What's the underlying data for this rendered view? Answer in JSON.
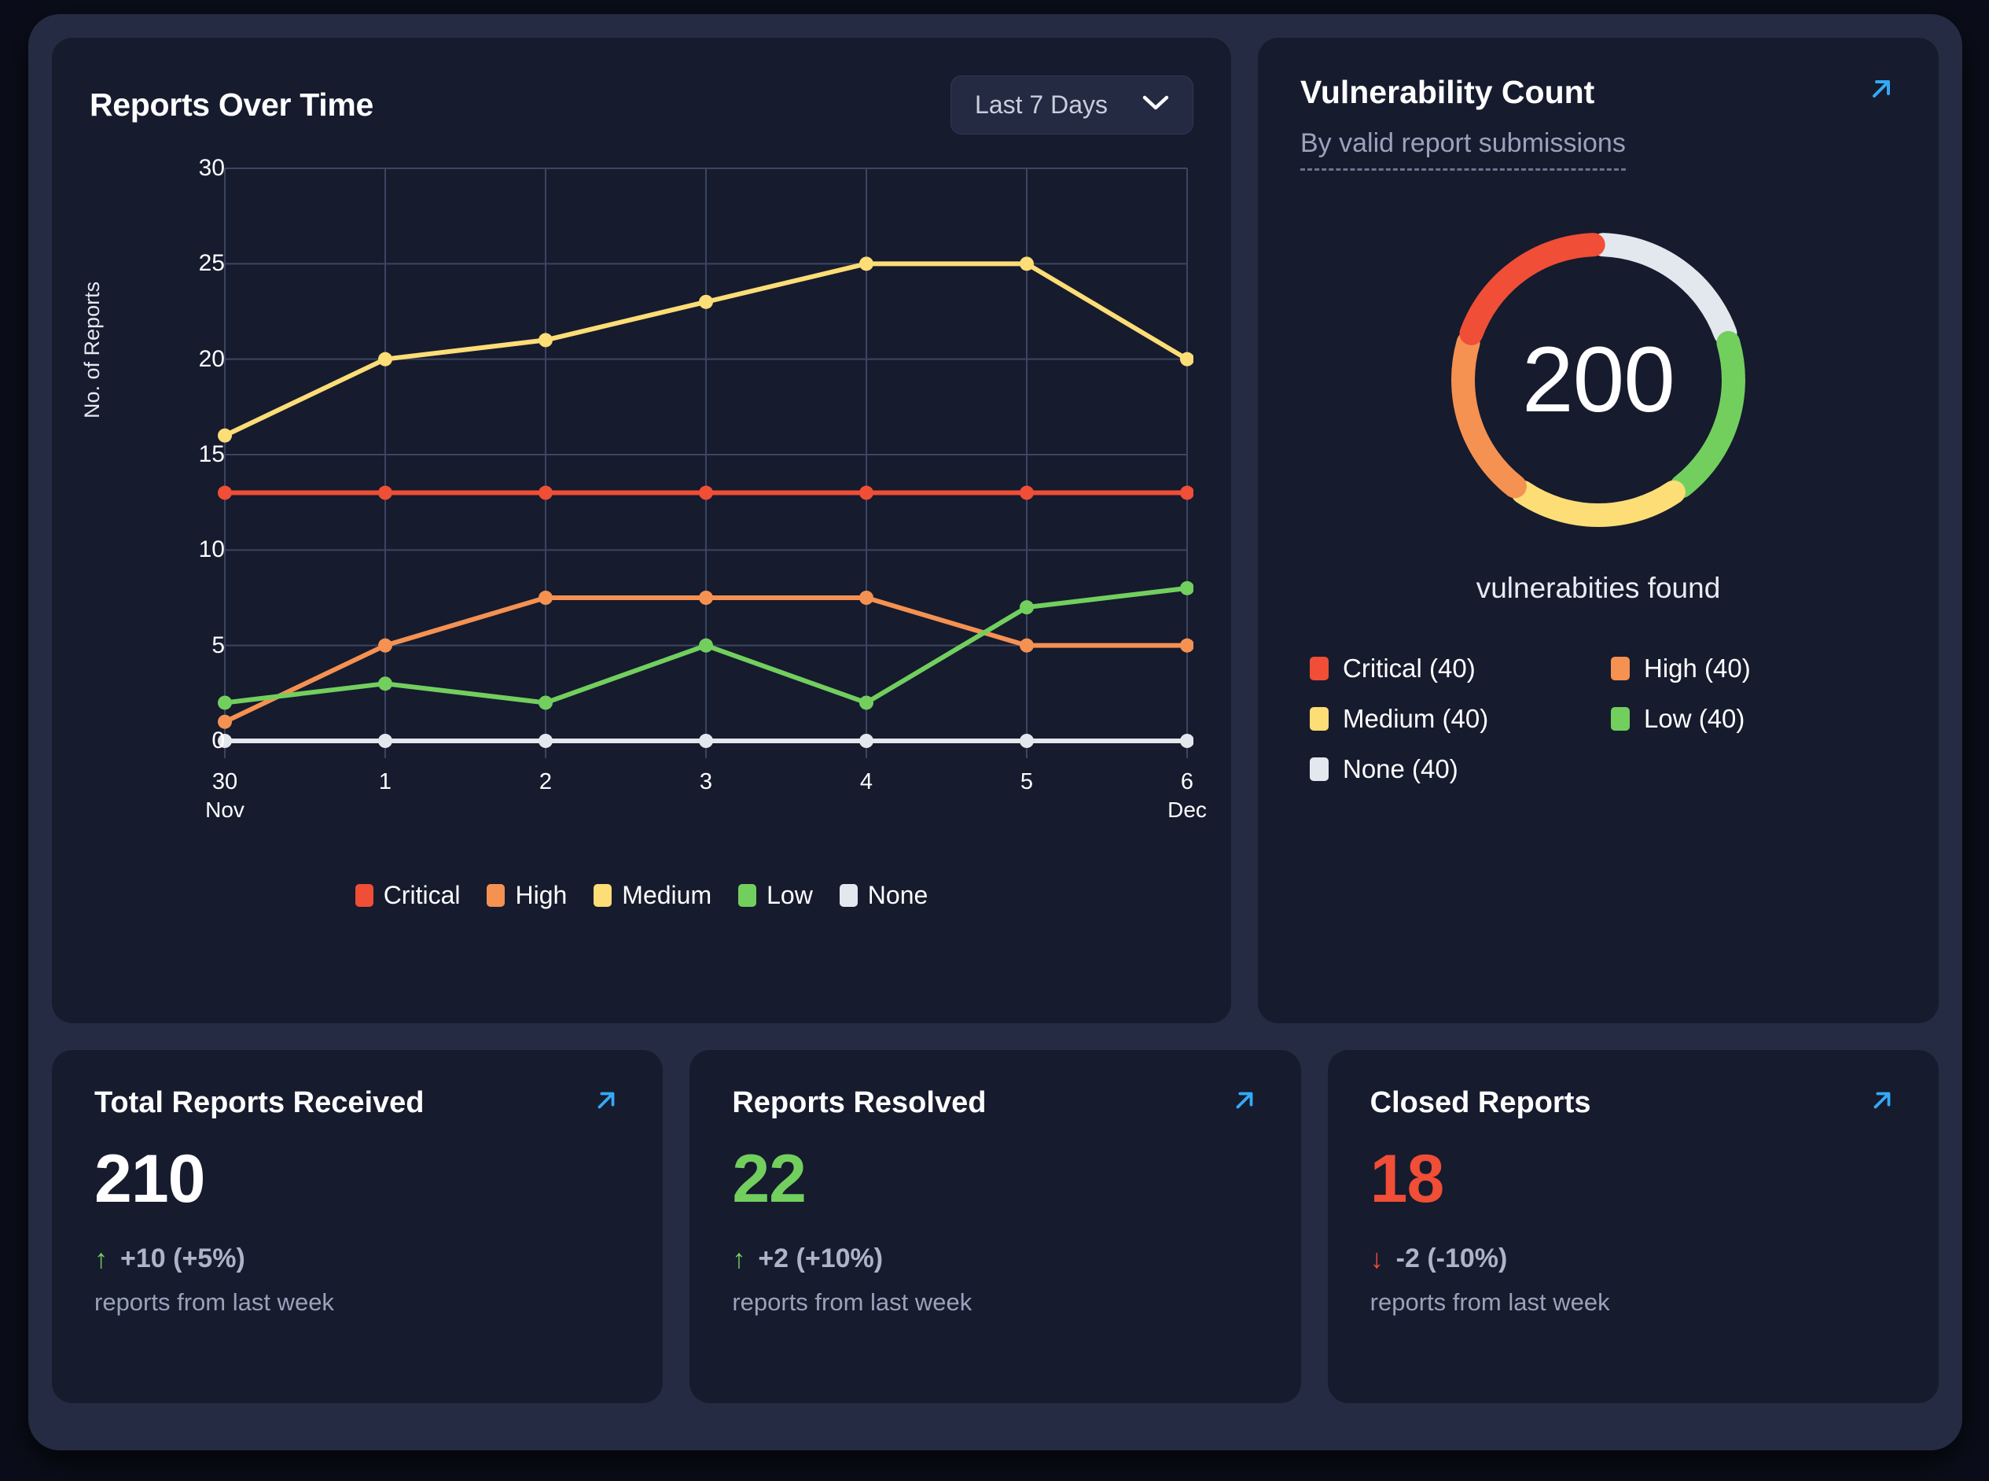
{
  "colors": {
    "critical": "#f04e36",
    "high": "#f59151",
    "medium": "#fcdd76",
    "low": "#72cf5e",
    "none": "#e3e7ee",
    "accent_link": "#34a9f5",
    "up": "#72cf5e",
    "down": "#f04e36",
    "card_bg": "#161b2e",
    "frame_bg": "#252b42",
    "grid": "#3c4560"
  },
  "reports_over_time": {
    "title": "Reports Over Time",
    "range_label": "Last 7 Days",
    "chevron_icon": "chevron-down-icon"
  },
  "vulnerability": {
    "title": "Vulnerability Count",
    "subtitle": "By valid report submissions",
    "total": "200",
    "found_label": "vulnerabities found",
    "link_icon": "arrow-up-right-icon",
    "legend": [
      {
        "label": "Critical (40)",
        "color": "#f04e36"
      },
      {
        "label": "High (40)",
        "color": "#f59151"
      },
      {
        "label": "Medium (40)",
        "color": "#fcdd76"
      },
      {
        "label": "Low (40)",
        "color": "#72cf5e"
      },
      {
        "label": "None (40)",
        "color": "#e3e7ee"
      }
    ]
  },
  "stats": [
    {
      "title": "Total Reports Received",
      "value": "210",
      "value_color": "#ffffff",
      "arrow": "↑",
      "arrow_color": "#72cf5e",
      "delta": "+10 (+5%)",
      "sub": "reports from last week"
    },
    {
      "title": "Reports Resolved",
      "value": "22",
      "value_color": "#72cf5e",
      "arrow": "↑",
      "arrow_color": "#72cf5e",
      "delta": "+2 (+10%)",
      "sub": "reports from last week"
    },
    {
      "title": "Closed Reports",
      "value": "18",
      "value_color": "#f04e36",
      "arrow": "↓",
      "arrow_color": "#f04e36",
      "delta": "-2 (-10%)",
      "sub": "reports from last week"
    }
  ],
  "chart_data": {
    "type": "line",
    "title": "Reports Over Time",
    "xlabel": "",
    "ylabel": "No. of Reports",
    "ylim": [
      0,
      30
    ],
    "yticks": [
      0,
      5,
      10,
      15,
      20,
      25,
      30
    ],
    "grid": true,
    "legend_position": "bottom",
    "x": [
      "30 Nov",
      "1",
      "2",
      "3",
      "4",
      "5",
      "6 Dec"
    ],
    "xtick_labels": [
      {
        "main": "30",
        "sub": "Nov"
      },
      {
        "main": "1",
        "sub": ""
      },
      {
        "main": "2",
        "sub": ""
      },
      {
        "main": "3",
        "sub": ""
      },
      {
        "main": "4",
        "sub": ""
      },
      {
        "main": "5",
        "sub": ""
      },
      {
        "main": "6",
        "sub": "Dec"
      }
    ],
    "series": [
      {
        "name": "Critical",
        "color": "#f04e36",
        "values": [
          13,
          13,
          13,
          13,
          13,
          13,
          13
        ]
      },
      {
        "name": "High",
        "color": "#f59151",
        "values": [
          1,
          5,
          7.5,
          7.5,
          7.5,
          5,
          5
        ]
      },
      {
        "name": "Medium",
        "color": "#fcdd76",
        "values": [
          16,
          20,
          21,
          23,
          25,
          25,
          20
        ]
      },
      {
        "name": "Low",
        "color": "#72cf5e",
        "values": [
          2,
          3,
          2,
          5,
          2,
          7,
          8
        ]
      },
      {
        "name": "None",
        "color": "#e3e7ee",
        "values": [
          0,
          0,
          0,
          0,
          0,
          0,
          0
        ]
      }
    ]
  },
  "donut_segments": [
    {
      "name": "None",
      "value": 40,
      "color": "#e3e7ee"
    },
    {
      "name": "Low",
      "value": 40,
      "color": "#72cf5e"
    },
    {
      "name": "Medium",
      "value": 40,
      "color": "#fcdd76"
    },
    {
      "name": "High",
      "value": 40,
      "color": "#f59151"
    },
    {
      "name": "Critical",
      "value": 40,
      "color": "#f04e36"
    }
  ]
}
